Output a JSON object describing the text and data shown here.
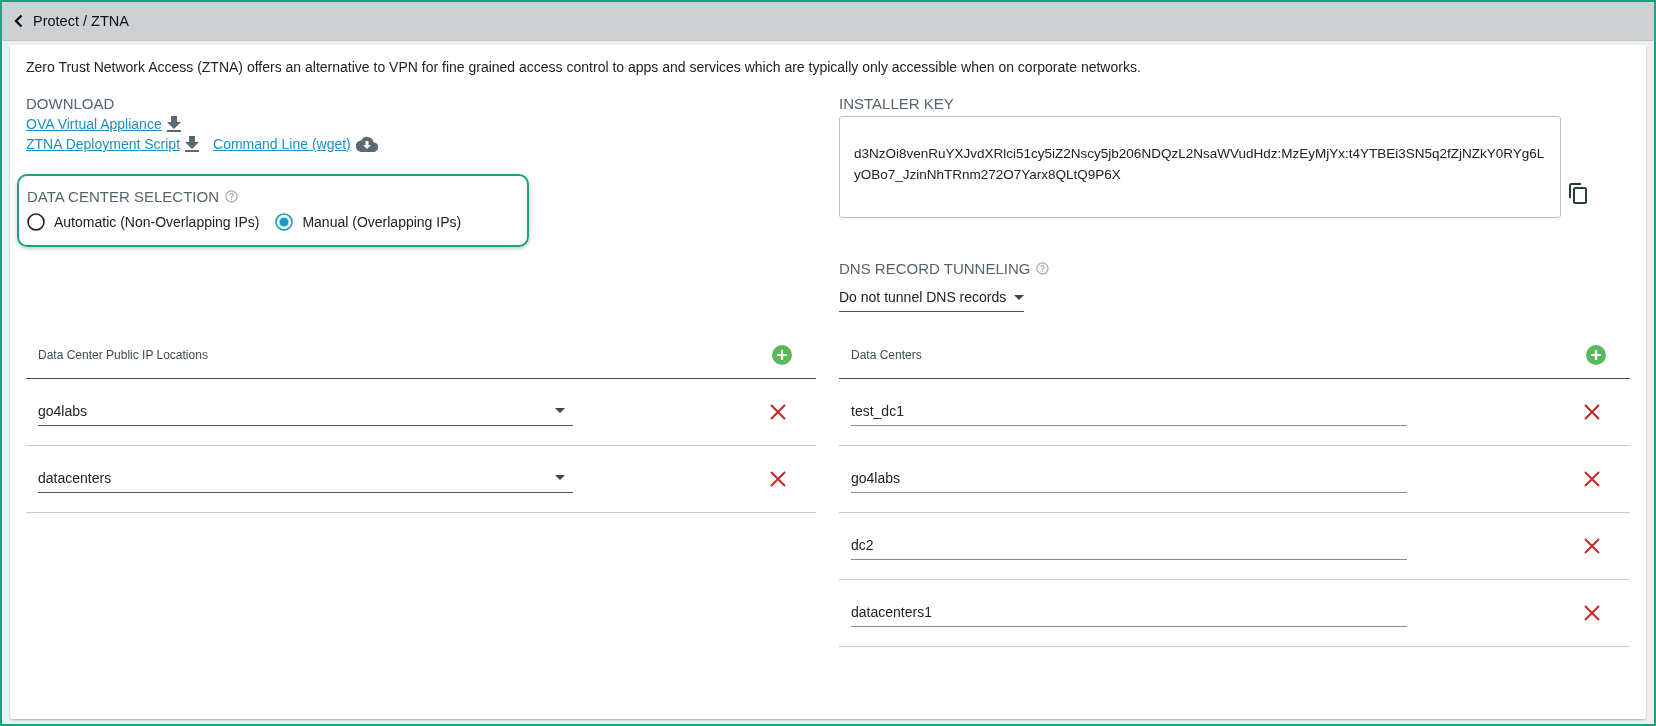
{
  "header": {
    "breadcrumb": "Protect / ZTNA"
  },
  "intro": "Zero Trust Network Access (ZTNA) offers an alternative to VPN for fine grained access control to apps and services which are typically only accessible when on corporate networks.",
  "download": {
    "title": "DOWNLOAD",
    "link_rows": [
      [
        {
          "label": "OVA Virtual Appliance",
          "kind": "download"
        }
      ],
      [
        {
          "label": "ZTNA Deployment Script",
          "kind": "download"
        },
        {
          "label": "Command Line (wget)",
          "kind": "cloud"
        }
      ]
    ]
  },
  "installer_key": {
    "title": "INSTALLER KEY",
    "value": "d3NzOi8venRuYXJvdXRlci51cy5iZ2Nscy5jb206NDQzL2NsaWVudHdz:MzEyMjYx:t4YTBEi3SN5q2fZjNZkY0RYg6LyOBo7_JzinNhTRnm272O7Yarx8QLtQ9P6X"
  },
  "data_center_selection": {
    "title": "DATA CENTER SELECTION",
    "options": [
      {
        "label": "Automatic (Non-Overlapping IPs)",
        "selected": false
      },
      {
        "label": "Manual (Overlapping IPs)",
        "selected": true
      }
    ]
  },
  "dns_record_tunneling": {
    "title": "DNS RECORD TUNNELING",
    "value": "Do not tunnel DNS records"
  },
  "public_ip_locations": {
    "title": "Data Center Public IP Locations",
    "rows": [
      {
        "value": "go4labs",
        "kind": "select"
      },
      {
        "value": "datacenters",
        "kind": "select"
      }
    ]
  },
  "data_centers": {
    "title": "Data Centers",
    "rows": [
      {
        "value": "test_dc1",
        "kind": "text"
      },
      {
        "value": "go4labs",
        "kind": "text"
      },
      {
        "value": "dc2",
        "kind": "text"
      },
      {
        "value": "datacenters1",
        "kind": "text"
      }
    ]
  }
}
